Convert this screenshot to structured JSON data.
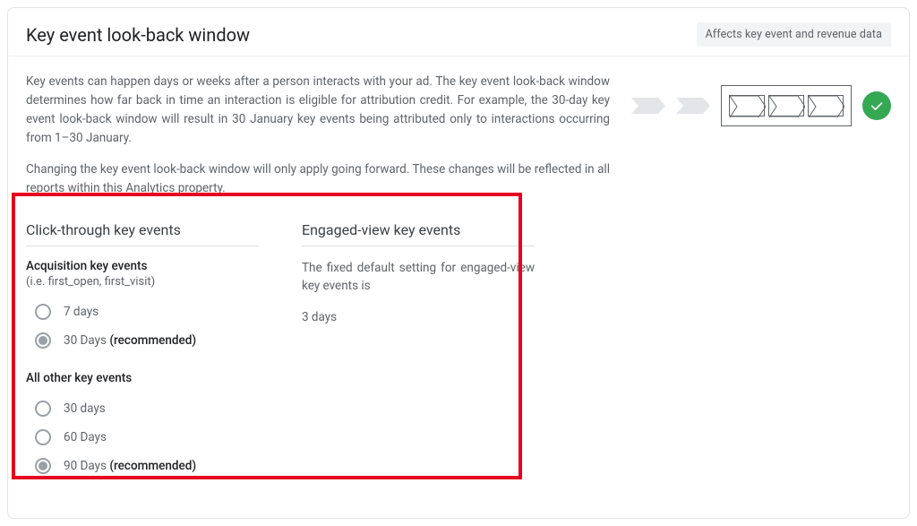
{
  "header": {
    "title": "Key event look-back window",
    "badge": "Affects key event and revenue data"
  },
  "description": {
    "p1": "Key events can happen days or weeks after a person interacts with your ad. The key event look-back window determines how far back in time an interaction is eligible for attribution credit. For example, the 30-day key event look-back window will result in 30 January key events being attributed only to interactions occurring from 1–30 January.",
    "p2": "Changing the key event look-back window will only apply going forward. These changes will be reflected in all reports within this Analytics property."
  },
  "click_through": {
    "title": "Click-through key events",
    "acq": {
      "heading": "Acquisition key events",
      "sub": "(i.e. first_open, first_visit)",
      "options": [
        {
          "label": "7 days",
          "selected": false,
          "rec": false
        },
        {
          "label": "30 Days",
          "selected": true,
          "rec": true,
          "rec_label": "(recommended)"
        }
      ]
    },
    "other": {
      "heading": "All other key events",
      "options": [
        {
          "label": "30 days",
          "selected": false,
          "rec": false
        },
        {
          "label": "60 Days",
          "selected": false,
          "rec": false
        },
        {
          "label": "90 Days",
          "selected": true,
          "rec": true,
          "rec_label": "(recommended)"
        }
      ]
    }
  },
  "engaged": {
    "title": "Engaged-view key events",
    "desc": "The fixed default setting for engaged-view key events is",
    "value": "3 days"
  }
}
